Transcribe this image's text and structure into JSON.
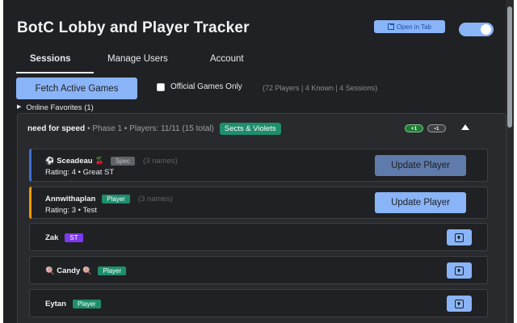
{
  "header": {
    "title": "BotC Lobby and Player Tracker",
    "open_in_tab": "Open in Tab"
  },
  "tabs": [
    {
      "label": "Sessions",
      "active": true
    },
    {
      "label": "Manage Users",
      "active": false
    },
    {
      "label": "Account",
      "active": false
    }
  ],
  "toolbar": {
    "fetch_label": "Fetch Active Games",
    "official_label": "Official Games Only",
    "counts": "(72 Players | 4 Known | 4 Sessions)"
  },
  "favorites": {
    "label": "Online Favorites (1)"
  },
  "session": {
    "name": "need for speed",
    "meta": "• Phase 1 • Players: 11/11 (15 total)",
    "script": "Sects & Violets",
    "pill_plus": "+1",
    "pill_minus": "•1"
  },
  "players": [
    {
      "name": "Sceadeau",
      "prefix": "⚽",
      "suffix": "🍒",
      "badge": "Spec",
      "names": "(3 names)",
      "rating": "Rating: 4 • Great ST",
      "button": "Update Player",
      "accent": "#3b6fd4"
    },
    {
      "name": "Annwithaplan",
      "badge": "Player",
      "names": "(3 names)",
      "rating": "Rating: 3 • Test",
      "button": "Update Player",
      "accent": "#f29900"
    },
    {
      "name": "Zak",
      "badge": "ST"
    },
    {
      "name": "Candy",
      "prefix": "🍭",
      "suffix": "🍭",
      "badge": "Player"
    },
    {
      "name": "Eytan",
      "badge": "Player"
    }
  ],
  "colors": {
    "background": "#202124",
    "accent": "#8ab4f8",
    "script_badge": "#1e8e6e",
    "st_badge": "#7c3aed"
  }
}
